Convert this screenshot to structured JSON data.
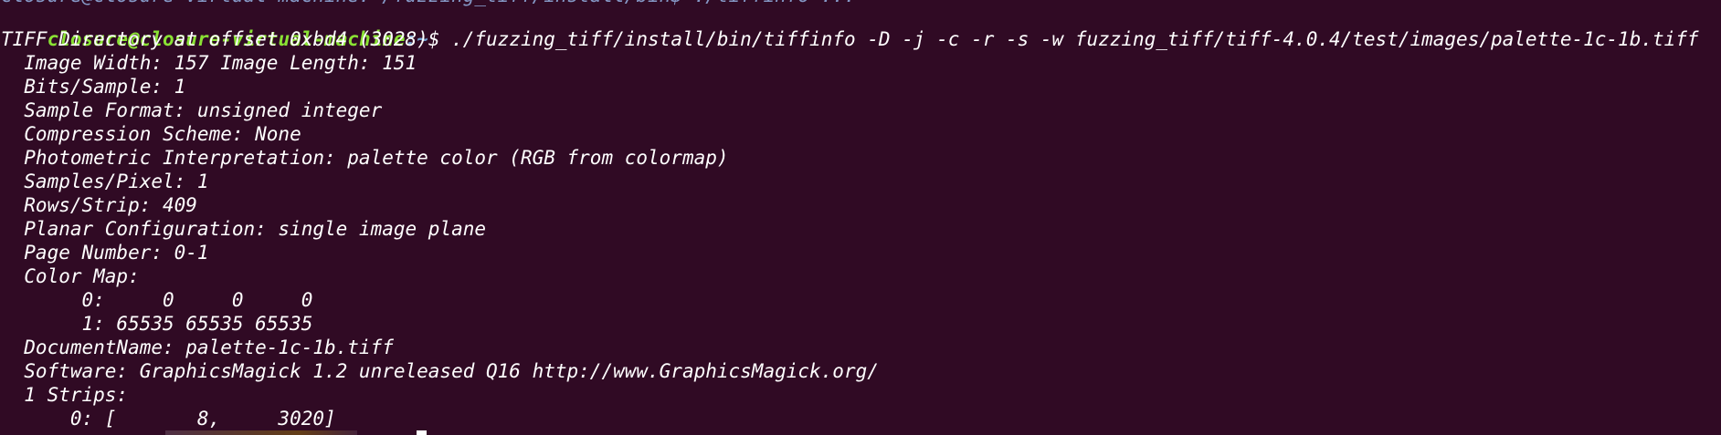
{
  "terminal": {
    "previous_line_fragment": "closure@closure-virtual-machine:~/fuzzing_tiff/install/bin$ ./tiffinfo ...",
    "prompt": {
      "user_host": "closure@closure-virtual-machine",
      "path": ":~",
      "symbol": "$ ",
      "command": "./fuzzing_tiff/install/bin/tiffinfo -D -j -c -r -s -w fuzzing_tiff/tiff-4.0.4/test/images/palette-1c-1b.tiff"
    },
    "output": [
      "TIFF Directory at offset 0xbd4 (3028)",
      "  Image Width: 157 Image Length: 151",
      "  Bits/Sample: 1",
      "  Sample Format: unsigned integer",
      "  Compression Scheme: None",
      "  Photometric Interpretation: palette color (RGB from colormap)",
      "  Samples/Pixel: 1",
      "  Rows/Strip: 409",
      "  Planar Configuration: single image plane",
      "  Page Number: 0-1",
      "  Color Map:",
      "       0:     0     0     0",
      "       1: 65535 65535 65535",
      "  DocumentName: palette-1c-1b.tiff",
      "  Software: GraphicsMagick 1.2 unreleased Q16 http://www.GraphicsMagick.org/",
      "  1 Strips:",
      "      0: [       8,     3020]"
    ],
    "colors": {
      "background": "#300a24",
      "foreground": "#ffffff",
      "user_host": "#8ae234",
      "path": "#729fcf"
    }
  }
}
